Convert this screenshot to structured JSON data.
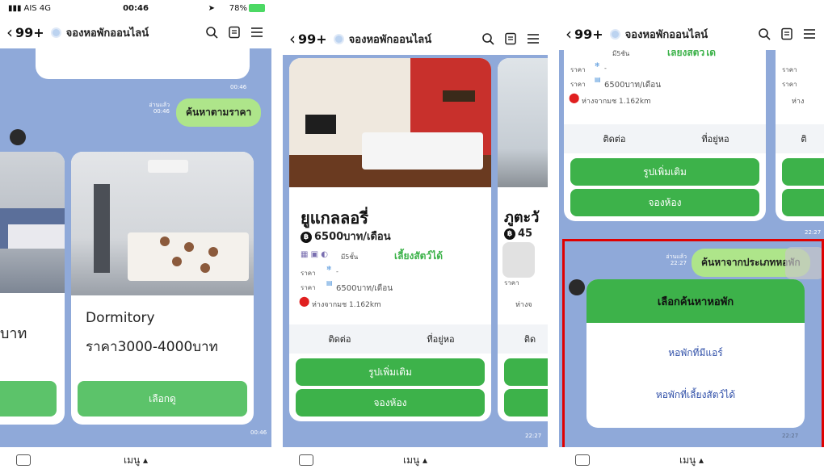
{
  "panel1": {
    "status": {
      "carrier": "AIS 4G",
      "time": "00:46",
      "battery": "78%"
    },
    "nav": {
      "back_count": "99+",
      "title": "จองหอพักออนไลน์"
    },
    "timestamp_top": "00:46",
    "read_label": "อ่านแล้ว",
    "read_time": "00:46",
    "search_bubble": "ค้นหาตามราคา",
    "card_partial_price": "บาท",
    "card": {
      "title": "Dormitory",
      "price": "ราคา3000-4000บาท",
      "button": "เลือกดู"
    },
    "timestamp_bottom": "00:46",
    "menu": "เมนู ▴"
  },
  "panel2": {
    "nav": {
      "back_count": "99+",
      "title": "จองหอพักออนไลน์"
    },
    "card": {
      "name": "ยูแกลลอรี่",
      "price": "6500บาท/เดือน",
      "floors": "มี5ชั้น",
      "pet": "เลี้ยงสัตว์ได้",
      "price_label1": "ราคา",
      "price_label2": "ราคา",
      "dash": "-",
      "monthly": "6500บาท/เดือน",
      "distance": "ห่างจากมช 1.162km",
      "contact": "ติดต่อ",
      "address": "ที่อยู่หอ",
      "more_photos": "รูปเพิ่มเติม",
      "book": "จองห้อง"
    },
    "card2_partial": {
      "name": "ภูตะวั",
      "price": "45",
      "label": "ราคา",
      "distance": "ห่างจ",
      "contact": "ติด"
    },
    "timestamp": "22:27",
    "menu": "เมนู ▴"
  },
  "panel3": {
    "nav": {
      "back_count": "99+",
      "title": "จองหอพักออนไลน์"
    },
    "card_top": {
      "floors": "มี5ชั้น",
      "pet": "เลี้ยงสัตว์ได้",
      "price_label1": "ราคา",
      "price_label2": "ราคา",
      "dash": "-",
      "monthly": "6500บาท/เดือน",
      "distance": "ห่างจากมช 1.162km",
      "contact": "ติดต่อ",
      "address": "ที่อยู่หอ",
      "more_photos": "รูปเพิ่มเติม",
      "book": "จองห้อง"
    },
    "card2_partial": {
      "label1": "ราคา",
      "label2": "ราคา",
      "distance": "ห่าง",
      "contact": "ติ"
    },
    "timestamp_mid": "22:27",
    "read_label": "อ่านแล้ว",
    "read_time": "22:27",
    "search_bubble": "ค้นหาจากประเภทหอพัก",
    "select_card": {
      "header": "เลือกค้นหาหอพัก",
      "option1": "หอพักที่มีแอร์",
      "option2": "หอพักที่เลี้ยงสัตว์ได้"
    },
    "timestamp_bottom": "22:27",
    "menu": "เมนู ▴"
  },
  "colors": {
    "chat_bg": "#8fa9d9",
    "green_bubble": "#aee58a",
    "green_button": "#3db24a",
    "highlight": "#e00000"
  }
}
